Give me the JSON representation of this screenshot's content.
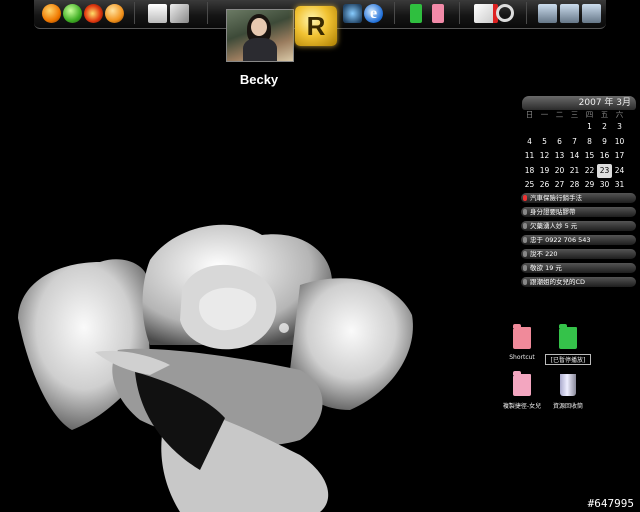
{
  "wallpaper": {
    "background": "#000000",
    "subject": "white rose"
  },
  "dock": {
    "groups": [
      {
        "icons": [
          "orange-sphere-icon",
          "green-sphere-icon",
          "fire-sphere-icon",
          "orange-ball-icon"
        ]
      },
      {
        "icons": [
          "text-document-icon",
          "picture-tool-icon"
        ]
      },
      {
        "icons": [
          "network-globe-icon",
          "internet-explorer-icon"
        ]
      },
      {
        "icons": [
          "green-folder-icon",
          "pink-folder-icon"
        ]
      },
      {
        "icons": [
          "red-disk-icon",
          "magnifier-icon"
        ]
      },
      {
        "icons": [
          "computer-icon",
          "computer-network-icon",
          "computer-sync-icon"
        ]
      }
    ],
    "launcher_letter": "R"
  },
  "profile": {
    "name": "Becky"
  },
  "calendar": {
    "header": "2007 年 3月",
    "weekdays": [
      "日",
      "一",
      "二",
      "三",
      "四",
      "五",
      "六"
    ],
    "weeks": [
      [
        "",
        "",
        "",
        "",
        "1",
        "2",
        "3"
      ],
      [
        "4",
        "5",
        "6",
        "7",
        "8",
        "9",
        "10"
      ],
      [
        "11",
        "12",
        "13",
        "14",
        "15",
        "16",
        "17"
      ],
      [
        "18",
        "19",
        "20",
        "21",
        "22",
        "23",
        "24"
      ],
      [
        "25",
        "26",
        "27",
        "28",
        "29",
        "30",
        "31"
      ]
    ],
    "today": "23"
  },
  "notes": [
    {
      "text": "汽車保險行銷手法",
      "active": true
    },
    {
      "text": "身分證要貼膠帶",
      "active": false
    },
    {
      "text": "欠藥湧人妙 5 元",
      "active": false
    },
    {
      "text": "忠于 0922 706 543",
      "active": false
    },
    {
      "text": "說不 220",
      "active": false
    },
    {
      "text": "敬欲 19 元",
      "active": false
    },
    {
      "text": "跟潮姐的女兒的CD",
      "active": false
    }
  ],
  "desktop_icons": [
    {
      "label": "Shortcut",
      "icon": "pink-folder-icon",
      "color": "#f08a9a"
    },
    {
      "label": "[已暫停播放]",
      "icon": "green-folder-icon",
      "color": "#35c24a"
    },
    {
      "label": "複製捷徑-女兒",
      "icon": "pink-folder-icon",
      "color": "#f3a6c0"
    },
    {
      "label": "資源回收筒",
      "icon": "recycle-bin-icon",
      "color": "#aab"
    }
  ],
  "watermark": "#647995"
}
